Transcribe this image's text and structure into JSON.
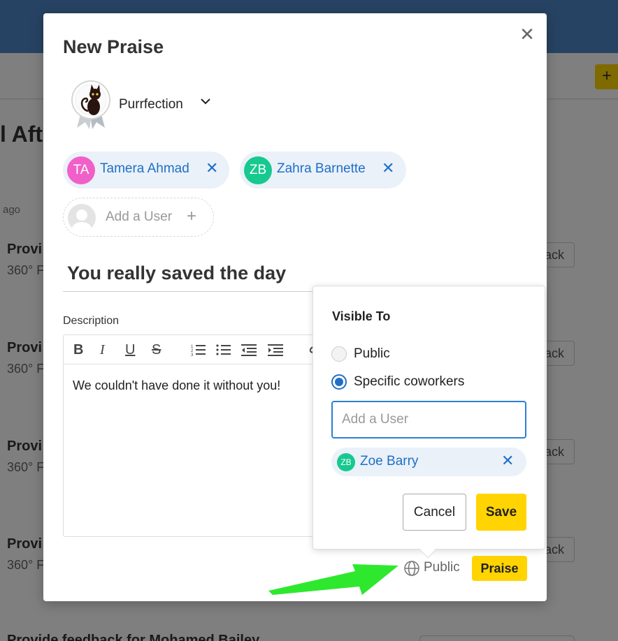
{
  "background": {
    "page_title_fragment": "l Aft",
    "time_fragment": "ago",
    "rows": [
      {
        "title": "Provi",
        "subtitle": "360° F",
        "button": "ack"
      },
      {
        "title": "Provi",
        "subtitle": "360° F",
        "button": "ack"
      },
      {
        "title": "Provi",
        "subtitle": "360° F",
        "button": "ack"
      },
      {
        "title": "Provi",
        "subtitle": "360° F",
        "button": "ack"
      }
    ],
    "footer_fragment": "Provide feedback for Mohamed Bailey",
    "add_icon": "plus-icon"
  },
  "modal": {
    "title": "New Praise",
    "close_icon": "close-icon",
    "badge": {
      "name": "Purrfection",
      "icon": "cat-ribbon-badge"
    },
    "recipients": [
      {
        "initials": "TA",
        "name": "Tamera Ahmad",
        "avatar_color": "#f060c8"
      },
      {
        "initials": "ZB",
        "name": "Zahra Barnette",
        "avatar_color": "#17c98f"
      }
    ],
    "add_user_label": "Add a User",
    "subject": "You really saved the day",
    "description_label": "Description",
    "description_text": "We couldn't have done it without you!",
    "visibility_label": "Public",
    "submit_label": "Praise"
  },
  "popover": {
    "title": "Visible To",
    "options": [
      "Public",
      "Specific coworkers"
    ],
    "selected_option": "Specific coworkers",
    "input_placeholder": "Add a User",
    "selected_users": [
      {
        "initials": "ZB",
        "name": "Zoe Barry",
        "avatar_color": "#17c98f"
      }
    ],
    "cancel_label": "Cancel",
    "save_label": "Save"
  },
  "colors": {
    "accent_yellow": "#ffd400",
    "link_blue": "#1f6fc5",
    "annotation_green": "#2ee82e"
  }
}
